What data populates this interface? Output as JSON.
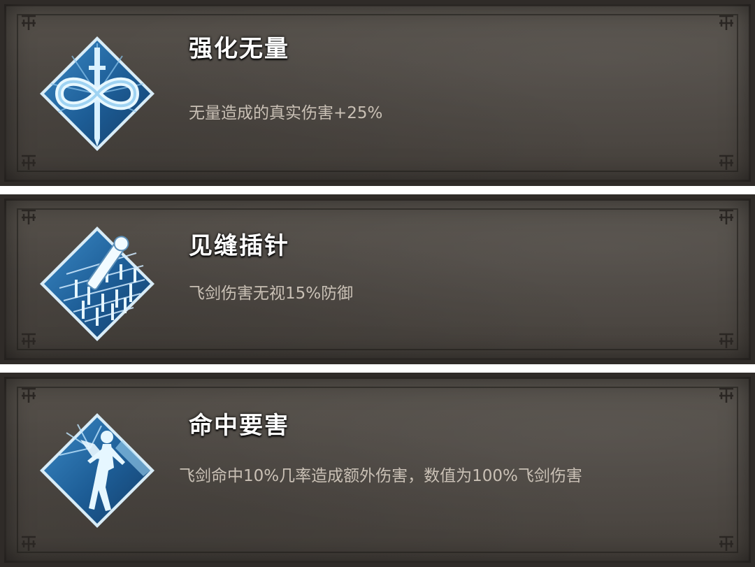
{
  "skills": [
    {
      "title": "强化无量",
      "description": "无量造成的真实伤害+25%",
      "icon": "infinity-sword-icon"
    },
    {
      "title": "见缝插针",
      "description": "飞剑伤害无视15%防御",
      "icon": "sword-grid-icon"
    },
    {
      "title": "命中要害",
      "description": "飞剑命中10%几率造成额外伤害，数值为100%飞剑伤害",
      "icon": "struck-figure-icon"
    }
  ],
  "colors": {
    "panel": "#4d4843",
    "title": "#ffffff",
    "description": "#c9c0b5",
    "icon_blue": "#1f5f96",
    "icon_glow": "#bfe6ff"
  }
}
